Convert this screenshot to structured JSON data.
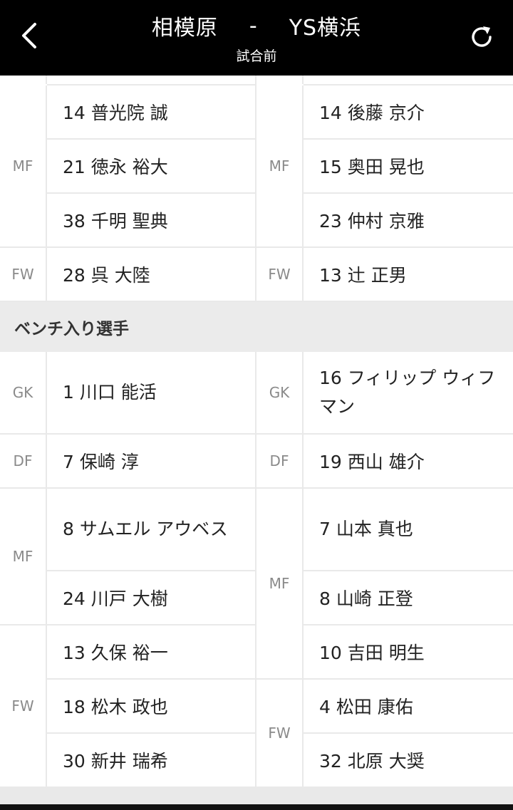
{
  "header": {
    "home_team": "相模原",
    "separator": "-",
    "away_team": "YS横浜",
    "status": "試合前"
  },
  "starters": {
    "home": [
      {
        "position": "MF",
        "players": [
          "14 普光院 誠",
          "21 徳永 裕大",
          "38 千明 聖典"
        ]
      },
      {
        "position": "FW",
        "players": [
          "28 呉 大陸"
        ]
      }
    ],
    "away": [
      {
        "position": "MF",
        "players": [
          "14 後藤 京介",
          "15 奥田 晃也",
          "23 仲村 京雅"
        ]
      },
      {
        "position": "FW",
        "players": [
          "13 辻 正男"
        ]
      }
    ]
  },
  "bench": {
    "title": "ベンチ入り選手",
    "home": [
      {
        "position": "GK",
        "players": [
          "1 川口 能活"
        ]
      },
      {
        "position": "DF",
        "players": [
          "7 保崎 淳"
        ]
      },
      {
        "position": "MF",
        "players": [
          "8 サムエル アウベス",
          "24 川戸 大樹"
        ]
      },
      {
        "position": "FW",
        "players": [
          "13 久保 裕一",
          "18 松木 政也",
          "30 新井 瑞希"
        ]
      }
    ],
    "away": [
      {
        "position": "GK",
        "players": [
          "16 フィリップ ウィフマン"
        ]
      },
      {
        "position": "DF",
        "players": [
          "19 西山 雄介"
        ]
      },
      {
        "position": "MF",
        "players": [
          "7 山本 真也",
          "8 山崎 正登",
          "10 吉田 明生"
        ]
      },
      {
        "position": "FW",
        "players": [
          "4 松田 康佑",
          "32 北原 大奨"
        ]
      }
    ]
  },
  "icons": {
    "back": "chevron-left-icon",
    "reload": "reload-icon"
  }
}
